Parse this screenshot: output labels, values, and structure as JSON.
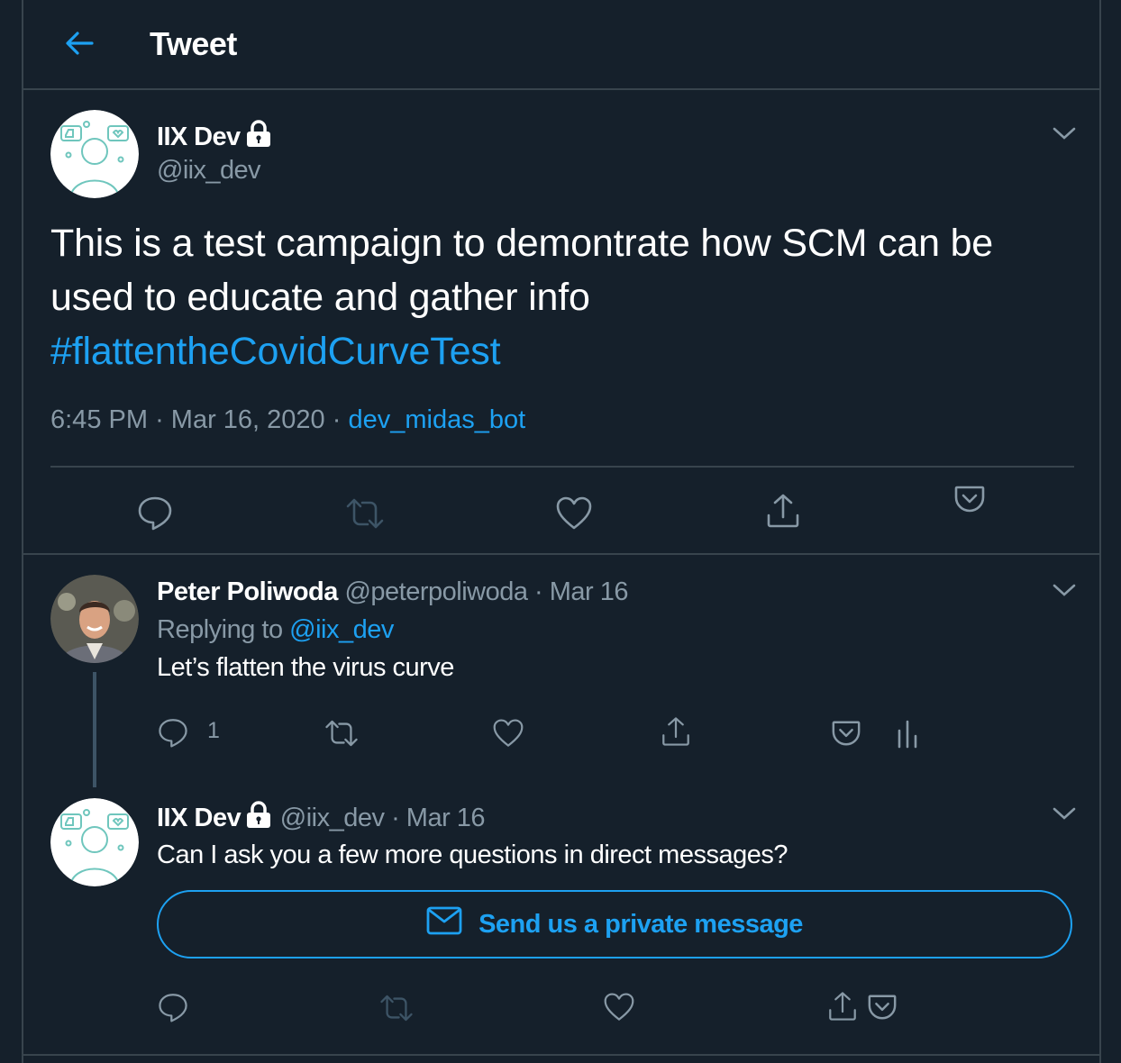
{
  "header": {
    "title": "Tweet"
  },
  "main_tweet": {
    "name": "IIX Dev",
    "handle": "@iix_dev",
    "text": "This is a test campaign to demontrate how SCM can be used to educate and gather info",
    "hashtag": "#flattentheCovidCurveTest",
    "time": "6:45 PM",
    "date": "Mar 16, 2020",
    "source": "dev_midas_bot",
    "dot": "·"
  },
  "reply1": {
    "name": "Peter Poliwoda",
    "handle": "@peterpoliwoda",
    "date": "Mar 16",
    "replying_label": "Replying to",
    "replying_to": "@iix_dev",
    "text": "Let’s flatten the virus curve",
    "reply_count": "1"
  },
  "reply2": {
    "name": "IIX Dev",
    "handle": "@iix_dev",
    "date": "Mar 16",
    "text": "Can I ask you a few more questions in direct messages?",
    "dm_button": "Send us a private message"
  },
  "colors": {
    "background": "#15202b",
    "accent": "#1da1f2",
    "muted": "#8899a6",
    "border": "#38444d"
  }
}
